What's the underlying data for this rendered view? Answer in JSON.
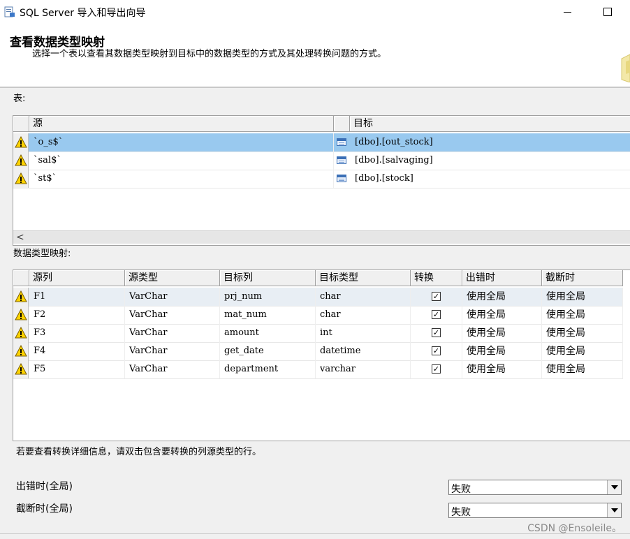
{
  "window": {
    "title": "SQL Server 导入和导出向导"
  },
  "header": {
    "title": "查看数据类型映射",
    "subtitle": "选择一个表以查看其数据类型映射到目标中的数据类型的方式及其处理转换问题的方式。"
  },
  "tables_section": {
    "label": "表:",
    "columns": [
      "源",
      "目标"
    ],
    "rows": [
      {
        "source": "`o_s$`",
        "target": "[dbo].[out_stock]",
        "selected": true
      },
      {
        "source": "`sal$`",
        "target": "[dbo].[salvaging]",
        "selected": false
      },
      {
        "source": "`st$`",
        "target": "[dbo].[stock]",
        "selected": false
      }
    ],
    "scroll_left_glyph": "<"
  },
  "mapping_section": {
    "label": "数据类型映射:",
    "columns": [
      "源列",
      "源类型",
      "目标列",
      "目标类型",
      "转换",
      "出错时",
      "截断时"
    ],
    "rows": [
      {
        "src_col": "F1",
        "src_type": "VarChar",
        "dst_col": "prj_num",
        "dst_type": "char",
        "convert": true,
        "on_error": "使用全局",
        "on_trunc": "使用全局"
      },
      {
        "src_col": "F2",
        "src_type": "VarChar",
        "dst_col": "mat_num",
        "dst_type": "char",
        "convert": true,
        "on_error": "使用全局",
        "on_trunc": "使用全局"
      },
      {
        "src_col": "F3",
        "src_type": "VarChar",
        "dst_col": "amount",
        "dst_type": "int",
        "convert": true,
        "on_error": "使用全局",
        "on_trunc": "使用全局"
      },
      {
        "src_col": "F4",
        "src_type": "VarChar",
        "dst_col": "get_date",
        "dst_type": "datetime",
        "convert": true,
        "on_error": "使用全局",
        "on_trunc": "使用全局"
      },
      {
        "src_col": "F5",
        "src_type": "VarChar",
        "dst_col": "department",
        "dst_type": "varchar",
        "convert": true,
        "on_error": "使用全局",
        "on_trunc": "使用全局"
      }
    ]
  },
  "hint": "若要查看转换详细信息，请双击包含要转换的列源类型的行。",
  "global_settings": {
    "on_error_label": "出错时(全局)",
    "on_error_value": "失败",
    "on_trunc_label": "截断时(全局)",
    "on_trunc_value": "失败"
  },
  "watermark": "CSDN @Ensoleile。",
  "icons": {
    "warning": "warning-icon",
    "table": "table-icon",
    "check": "✓"
  },
  "colors": {
    "selection": "#99c9ef",
    "warning_fill": "#ffd200"
  }
}
